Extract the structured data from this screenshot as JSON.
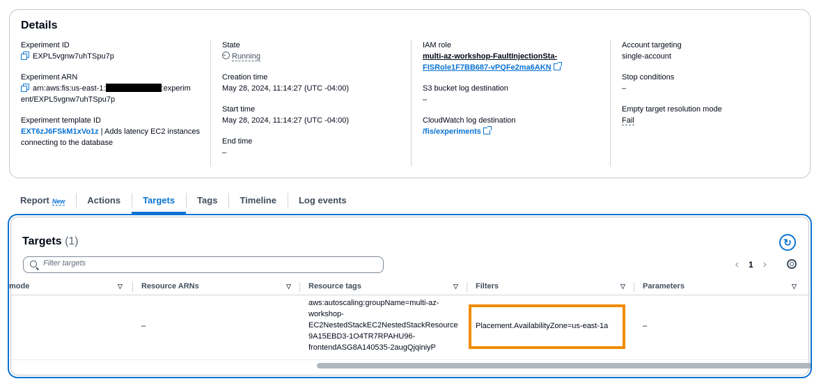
{
  "details": {
    "title": "Details",
    "experiment_id": {
      "label": "Experiment ID",
      "value": "EXPL5vgnw7uhTSpu7p"
    },
    "experiment_arn": {
      "label": "Experiment ARN",
      "value_prefix": "arn:aws:fis:us-east-1:",
      "value_suffix": ":experim",
      "value_line2": "ent/EXPL5vgnw7uhTSpu7p"
    },
    "experiment_template_id": {
      "label": "Experiment template ID",
      "link": "EXT6zJ6FSkM1xVo1z",
      "desc": " | Adds latency EC2 instances",
      "desc_line2": "connecting to the database"
    },
    "state": {
      "label": "State",
      "value": "Running"
    },
    "creation_time": {
      "label": "Creation time",
      "value": "May 28, 2024, 11:14:27 (UTC -04:00)"
    },
    "start_time": {
      "label": "Start time",
      "value": "May 28, 2024, 11:14:27 (UTC -04:00)"
    },
    "end_time": {
      "label": "End time",
      "value": "–"
    },
    "iam_role": {
      "label": "IAM role",
      "line1": "multi-az-workshop-FaultInjectionSta-",
      "line2": "FISRole1F7BB687-vPQFe2ma6AKN"
    },
    "s3_log": {
      "label": "S3 bucket log destination",
      "value": "–"
    },
    "cloudwatch_log": {
      "label": "CloudWatch log destination",
      "value": "/fis/experiments"
    },
    "account_targeting": {
      "label": "Account targeting",
      "value": "single-account"
    },
    "stop_conditions": {
      "label": "Stop conditions",
      "value": "–"
    },
    "empty_target": {
      "label": "Empty target resolution mode",
      "value": "Fail"
    }
  },
  "tabs": [
    {
      "label": "Report",
      "badge": "New"
    },
    {
      "label": "Actions"
    },
    {
      "label": "Targets"
    },
    {
      "label": "Tags"
    },
    {
      "label": "Timeline"
    },
    {
      "label": "Log events"
    }
  ],
  "targets": {
    "title": "Targets",
    "count": "(1)",
    "search_placeholder": "Filter targets",
    "page": "1",
    "columns": [
      "mode",
      "Resource ARNs",
      "Resource tags",
      "Filters",
      "Parameters"
    ],
    "row": {
      "mode": "",
      "resource_arns": "–",
      "resource_tags": [
        "aws:autoscaling:groupName=multi-az-",
        "workshop-",
        "EC2NestedStackEC2NestedStackResource",
        "9A15EBD3-1O4TR7RPAHU96-",
        "frontendASG8A140535-2augQjqiniyP"
      ],
      "filters": "Placement.AvailabilityZone=us-east-1a",
      "parameters": "–"
    }
  },
  "icons": {
    "copy": "copy-icon",
    "external": "external-link-icon",
    "status": "status-pending-icon",
    "refresh": "refresh-icon",
    "search": "search-icon",
    "settings": "settings-gear-icon",
    "sort": "sort-caret-icon"
  },
  "colors": {
    "link": "#0972d3",
    "highlight": "#f08c00"
  }
}
